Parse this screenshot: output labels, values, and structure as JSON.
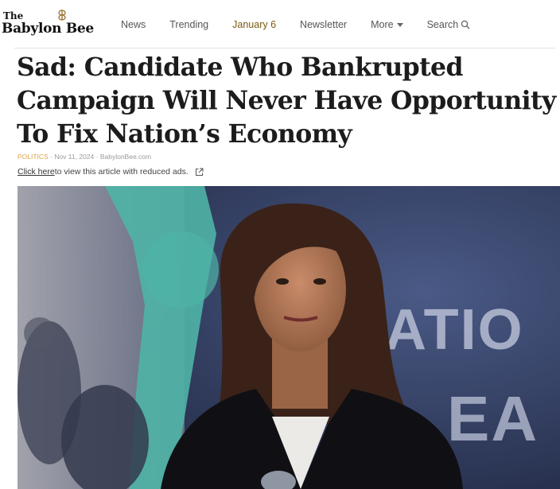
{
  "header": {
    "logo_small": "The",
    "logo_name": "Babylon Bee",
    "nav": [
      {
        "label": "News"
      },
      {
        "label": "Trending"
      },
      {
        "label": "January 6"
      },
      {
        "label": "Newsletter"
      },
      {
        "label": "More"
      },
      {
        "label": "Search"
      }
    ]
  },
  "article": {
    "headline": "Sad: Candidate Who Bankrupted Campaign Will Never Have Opportunity To Fix Nation’s Economy",
    "category": "POLITICS",
    "date": "Nov 11, 2024",
    "source": "BabylonBee.com",
    "reduced_ads_link": "Click here",
    "reduced_ads_text": " to view this article with reduced ads."
  },
  "hero": {
    "backdrop_text_top": "ATIO",
    "backdrop_text_bottom": "EA"
  },
  "colors": {
    "accent": "#e0a24a",
    "backdrop": "#2b3556",
    "teal": "#4fb4a6"
  },
  "icons": [
    "bee-logo-icon",
    "caret-down-icon",
    "search-icon",
    "external-link-icon"
  ]
}
